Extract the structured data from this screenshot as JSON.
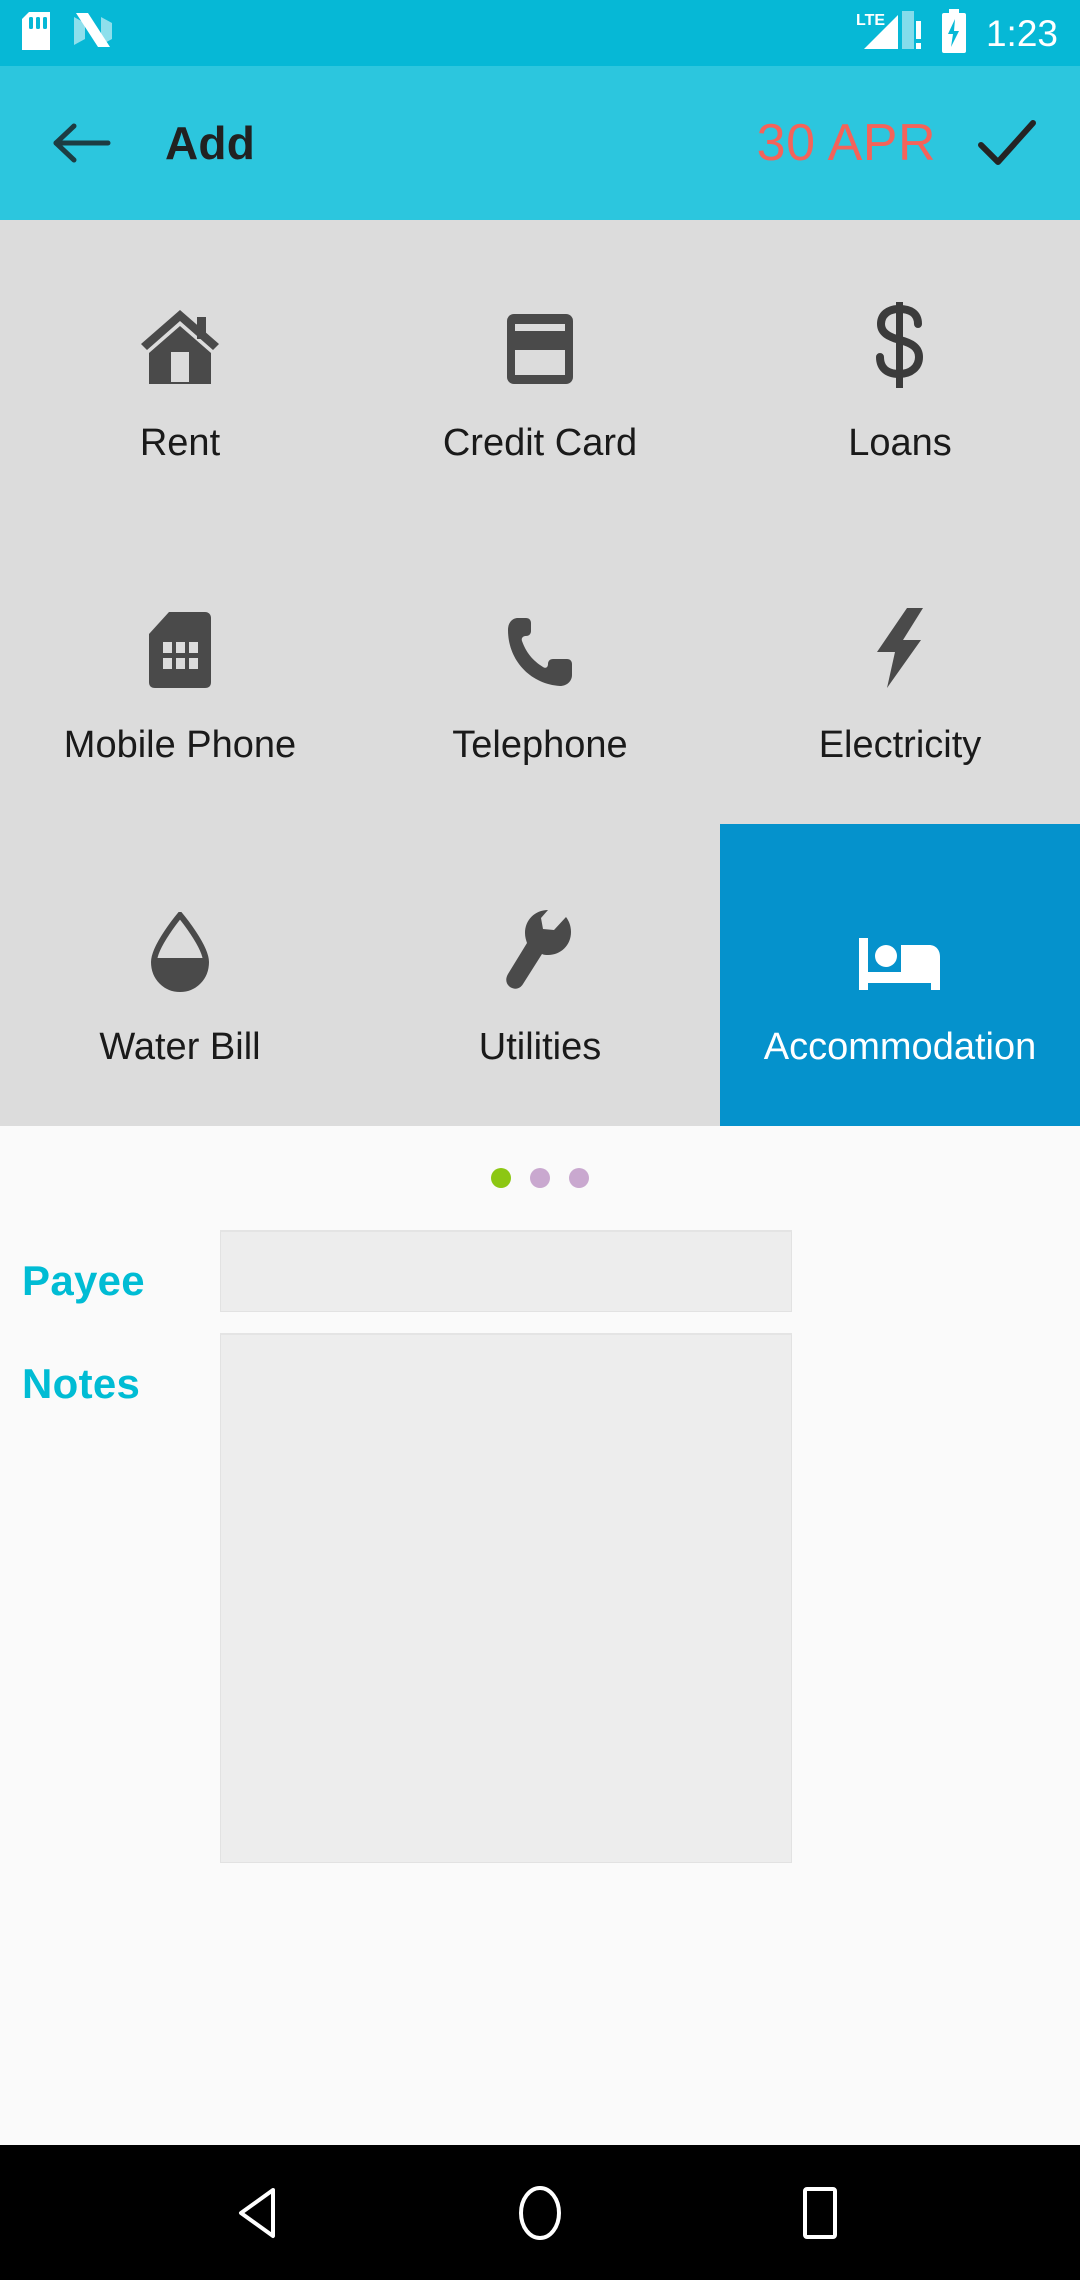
{
  "status_bar": {
    "icons": [
      "sd-card-icon",
      "android-nougat-icon"
    ],
    "network_label": "LTE",
    "network_warning": "!",
    "battery_state": "charging",
    "time": "1:23"
  },
  "app_bar": {
    "back_icon": "arrow-left-icon",
    "title": "Add",
    "date": "30 APR",
    "confirm_icon": "check-icon",
    "date_color": "#f4635a",
    "background_color": "#2cc6de"
  },
  "category_grid": {
    "selected_index": 8,
    "selected_color": "#0592cc",
    "background_color": "#dcdcdc",
    "items": [
      {
        "label": "Rent",
        "icon": "home-icon"
      },
      {
        "label": "Credit Card",
        "icon": "credit-card-icon"
      },
      {
        "label": "Loans",
        "icon": "dollar-sign-icon"
      },
      {
        "label": "Mobile Phone",
        "icon": "sim-card-icon"
      },
      {
        "label": "Telephone",
        "icon": "phone-handset-icon"
      },
      {
        "label": "Electricity",
        "icon": "lightning-bolt-icon"
      },
      {
        "label": "Water Bill",
        "icon": "water-drop-icon"
      },
      {
        "label": "Utilities",
        "icon": "wrench-icon"
      },
      {
        "label": "Accommodation",
        "icon": "bed-icon"
      }
    ]
  },
  "page_indicator": {
    "total": 3,
    "active_index": 0,
    "active_color": "#8cc713",
    "inactive_color": "#c9a8cf"
  },
  "form": {
    "payee": {
      "label": "Payee",
      "value": "",
      "placeholder": ""
    },
    "notes": {
      "label": "Notes",
      "value": "",
      "placeholder": ""
    },
    "label_color": "#00bcd4"
  },
  "nav_bar": {
    "back": "back-triangle-icon",
    "home": "home-circle-icon",
    "recents": "recents-square-icon"
  }
}
